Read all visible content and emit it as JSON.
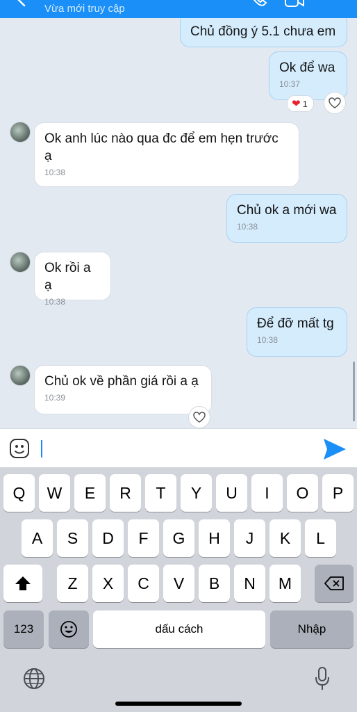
{
  "header": {
    "subtitle": "Vừa mới truy cập",
    "icons": [
      "back-icon",
      "phone-icon",
      "video-icon",
      "menu-icon"
    ],
    "background": "#1a8ff7"
  },
  "messages": [
    {
      "id": "m1",
      "side": "out",
      "text": "Chủ đồng ý 5.1 chưa em",
      "time": ""
    },
    {
      "id": "m2",
      "side": "out",
      "text": "Ok để wa",
      "time": "10:37",
      "reaction": {
        "emoji": "❤",
        "count": "1"
      }
    },
    {
      "id": "m3",
      "side": "in",
      "text": "Ok anh lúc nào qua đc để em hẹn trước ạ",
      "time": "10:38"
    },
    {
      "id": "m4",
      "side": "out",
      "text": "Chủ ok a mới wa",
      "time": "10:38"
    },
    {
      "id": "m5",
      "side": "in",
      "text": "Ok rồi a ạ",
      "time": "10:38"
    },
    {
      "id": "m6",
      "side": "out",
      "text": "Để đỡ mất tg",
      "time": "10:38"
    },
    {
      "id": "m7",
      "side": "in",
      "text": "Chủ ok về phần giá rồi a ạ",
      "time": "10:39"
    }
  ],
  "input": {
    "value": "",
    "icons": [
      "sticker-icon",
      "send-icon"
    ]
  },
  "keyboard": {
    "row1": [
      "Q",
      "W",
      "E",
      "R",
      "T",
      "Y",
      "U",
      "I",
      "O",
      "P"
    ],
    "row2": [
      "A",
      "S",
      "D",
      "F",
      "G",
      "H",
      "J",
      "K",
      "L"
    ],
    "row3": [
      "Z",
      "X",
      "C",
      "V",
      "B",
      "N",
      "M"
    ],
    "numbers_label": "123",
    "space_label": "dấu cách",
    "return_label": "Nhập",
    "icons": [
      "shift-icon",
      "backspace-icon",
      "emoji-icon",
      "globe-icon",
      "microphone-icon"
    ]
  }
}
